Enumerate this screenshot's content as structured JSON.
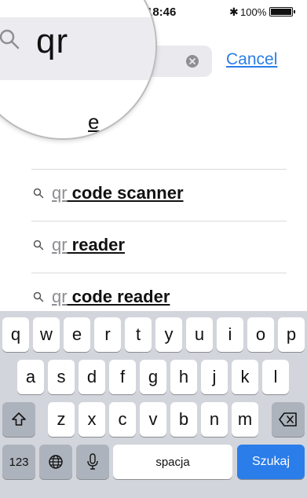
{
  "status_bar": {
    "time": "18:46",
    "bluetooth": "✱",
    "battery": "100%",
    "battery_icon": "battery-icon"
  },
  "search": {
    "query": "qr",
    "clear_icon": "clear-icon",
    "cancel_label": "Cancel"
  },
  "suggestions": [
    {
      "typed": "",
      "rest": "e",
      "icon": "search-icon"
    },
    {
      "typed": "qr",
      "rest": " code scanner",
      "icon": "search-icon"
    },
    {
      "typed": "qr",
      "rest": " reader",
      "icon": "search-icon"
    },
    {
      "typed": "qr",
      "rest": " code reader",
      "icon": "search-icon"
    }
  ],
  "keyboard": {
    "row1": [
      "q",
      "w",
      "e",
      "r",
      "t",
      "y",
      "u",
      "i",
      "o",
      "p"
    ],
    "row2": [
      "a",
      "s",
      "d",
      "f",
      "g",
      "h",
      "j",
      "k",
      "l"
    ],
    "row3": [
      "z",
      "x",
      "c",
      "v",
      "b",
      "n",
      "m"
    ],
    "numbers_label": "123",
    "space_label": "spacja",
    "search_label": "Szukaj",
    "shift_icon": "shift-icon",
    "backspace_icon": "backspace-icon",
    "globe_icon": "globe-icon",
    "mic_icon": "microphone-icon"
  },
  "colors": {
    "accent": "#2b7de9",
    "keyboard_bg": "#d2d5db",
    "special_key": "#adb3bc",
    "field_bg": "#e9e9ee"
  }
}
